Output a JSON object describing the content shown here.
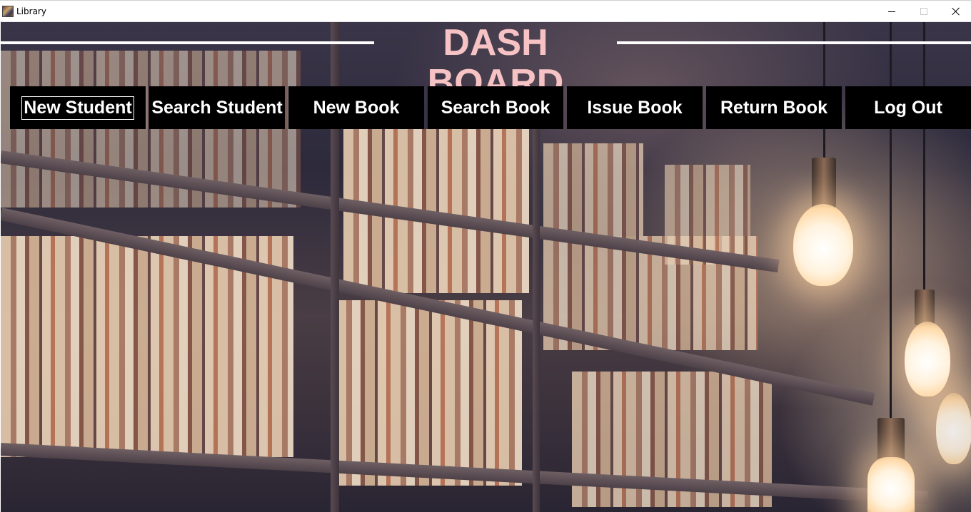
{
  "window": {
    "title": "Library",
    "controls": [
      "minimize",
      "maximize",
      "close"
    ]
  },
  "header": {
    "title": "DASH BOARD",
    "title_color": "#f7c2c4",
    "line_color": "#ffffff"
  },
  "nav": {
    "buttons": [
      {
        "label": "New Student",
        "focused": true
      },
      {
        "label": "Search Student"
      },
      {
        "label": "New Book"
      },
      {
        "label": "Search Book"
      },
      {
        "label": "Issue Book"
      },
      {
        "label": "Return Book"
      },
      {
        "label": "Log Out"
      }
    ],
    "button_bg": "#000000",
    "button_fg": "#ffffff"
  },
  "background": {
    "description_icon": "library-bookshelf-photo"
  }
}
